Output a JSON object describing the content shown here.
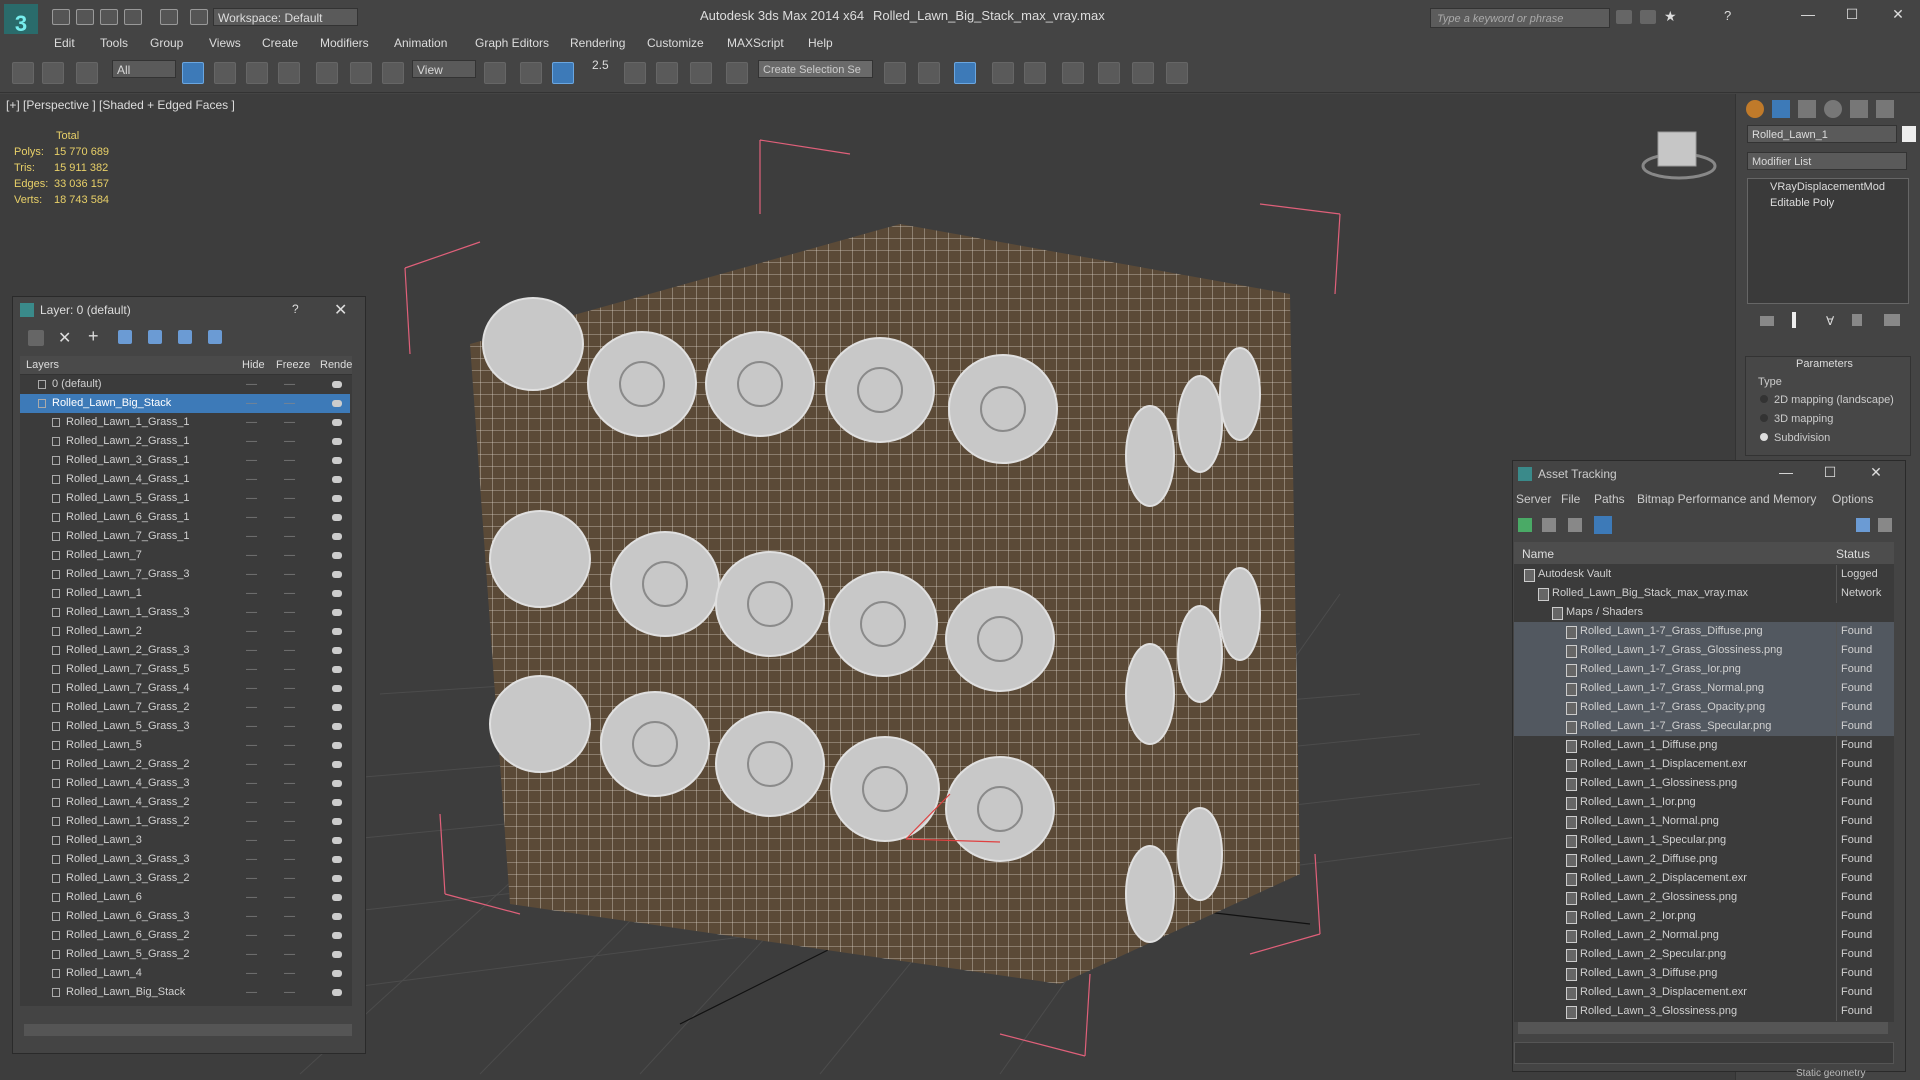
{
  "titlebar": {
    "workspace": "Workspace: Default",
    "app_title": "Autodesk 3ds Max  2014 x64",
    "file_title": "Rolled_Lawn_Big_Stack_max_vray.max",
    "search_placeholder": "Type a keyword or phrase"
  },
  "menu": [
    "Edit",
    "Tools",
    "Group",
    "Views",
    "Create",
    "Modifiers",
    "Animation",
    "Graph Editors",
    "Rendering",
    "Customize",
    "MAXScript",
    "Help"
  ],
  "toolbar": {
    "selection_filter": "All",
    "reference_coord": "View",
    "angle_snap": "2.5",
    "create_selection_set": "Create Selection Se"
  },
  "viewport": {
    "label": "[+] [Perspective ] [Shaded + Edged Faces ]",
    "stats_header": "Total",
    "stats": [
      {
        "label": "Polys:",
        "value": "15 770 689"
      },
      {
        "label": "Tris:",
        "value": "15 911 382"
      },
      {
        "label": "Edges:",
        "value": "33 036 157"
      },
      {
        "label": "Verts:",
        "value": "18 743 584"
      }
    ]
  },
  "layer_panel": {
    "title": "Layer: 0 (default)",
    "help": "?",
    "columns": [
      "Layers",
      "Hide",
      "Freeze",
      "Rende"
    ],
    "rows": [
      {
        "name": "0 (default)",
        "level": 1,
        "selected": false
      },
      {
        "name": "Rolled_Lawn_Big_Stack",
        "level": 1,
        "selected": true
      },
      {
        "name": "Rolled_Lawn_1_Grass_1",
        "level": 2,
        "selected": false
      },
      {
        "name": "Rolled_Lawn_2_Grass_1",
        "level": 2,
        "selected": false
      },
      {
        "name": "Rolled_Lawn_3_Grass_1",
        "level": 2,
        "selected": false
      },
      {
        "name": "Rolled_Lawn_4_Grass_1",
        "level": 2,
        "selected": false
      },
      {
        "name": "Rolled_Lawn_5_Grass_1",
        "level": 2,
        "selected": false
      },
      {
        "name": "Rolled_Lawn_6_Grass_1",
        "level": 2,
        "selected": false
      },
      {
        "name": "Rolled_Lawn_7_Grass_1",
        "level": 2,
        "selected": false
      },
      {
        "name": "Rolled_Lawn_7",
        "level": 2,
        "selected": false
      },
      {
        "name": "Rolled_Lawn_7_Grass_3",
        "level": 2,
        "selected": false
      },
      {
        "name": "Rolled_Lawn_1",
        "level": 2,
        "selected": false
      },
      {
        "name": "Rolled_Lawn_1_Grass_3",
        "level": 2,
        "selected": false
      },
      {
        "name": "Rolled_Lawn_2",
        "level": 2,
        "selected": false
      },
      {
        "name": "Rolled_Lawn_2_Grass_3",
        "level": 2,
        "selected": false
      },
      {
        "name": "Rolled_Lawn_7_Grass_5",
        "level": 2,
        "selected": false
      },
      {
        "name": "Rolled_Lawn_7_Grass_4",
        "level": 2,
        "selected": false
      },
      {
        "name": "Rolled_Lawn_7_Grass_2",
        "level": 2,
        "selected": false
      },
      {
        "name": "Rolled_Lawn_5_Grass_3",
        "level": 2,
        "selected": false
      },
      {
        "name": "Rolled_Lawn_5",
        "level": 2,
        "selected": false
      },
      {
        "name": "Rolled_Lawn_2_Grass_2",
        "level": 2,
        "selected": false
      },
      {
        "name": "Rolled_Lawn_4_Grass_3",
        "level": 2,
        "selected": false
      },
      {
        "name": "Rolled_Lawn_4_Grass_2",
        "level": 2,
        "selected": false
      },
      {
        "name": "Rolled_Lawn_1_Grass_2",
        "level": 2,
        "selected": false
      },
      {
        "name": "Rolled_Lawn_3",
        "level": 2,
        "selected": false
      },
      {
        "name": "Rolled_Lawn_3_Grass_3",
        "level": 2,
        "selected": false
      },
      {
        "name": "Rolled_Lawn_3_Grass_2",
        "level": 2,
        "selected": false
      },
      {
        "name": "Rolled_Lawn_6",
        "level": 2,
        "selected": false
      },
      {
        "name": "Rolled_Lawn_6_Grass_3",
        "level": 2,
        "selected": false
      },
      {
        "name": "Rolled_Lawn_6_Grass_2",
        "level": 2,
        "selected": false
      },
      {
        "name": "Rolled_Lawn_5_Grass_2",
        "level": 2,
        "selected": false
      },
      {
        "name": "Rolled_Lawn_4",
        "level": 2,
        "selected": false
      },
      {
        "name": "Rolled_Lawn_Big_Stack",
        "level": 2,
        "selected": false
      }
    ]
  },
  "command_panel": {
    "object_name": "Rolled_Lawn_1",
    "modifier_list": "Modifier List",
    "modifiers": [
      "VRayDisplacementMod",
      "Editable Poly"
    ],
    "parameters_title": "Parameters",
    "type_label": "Type",
    "type_options": [
      "2D mapping (landscape)",
      "3D mapping",
      "Subdivision"
    ],
    "type_selected": "Subdivision"
  },
  "asset_tracking": {
    "title": "Asset Tracking",
    "menu": [
      "Server",
      "File",
      "Paths",
      "Bitmap Performance and Memory",
      "Options"
    ],
    "columns": [
      "Name",
      "Status"
    ],
    "rows": [
      {
        "name": "Autodesk Vault",
        "status": "Logged",
        "level": 0,
        "highlight": false
      },
      {
        "name": "Rolled_Lawn_Big_Stack_max_vray.max",
        "status": "Network",
        "level": 1,
        "highlight": false
      },
      {
        "name": "Maps / Shaders",
        "status": "",
        "level": 2,
        "highlight": false
      },
      {
        "name": "Rolled_Lawn_1-7_Grass_Diffuse.png",
        "status": "Found",
        "level": 3,
        "highlight": true
      },
      {
        "name": "Rolled_Lawn_1-7_Grass_Glossiness.png",
        "status": "Found",
        "level": 3,
        "highlight": true
      },
      {
        "name": "Rolled_Lawn_1-7_Grass_Ior.png",
        "status": "Found",
        "level": 3,
        "highlight": true
      },
      {
        "name": "Rolled_Lawn_1-7_Grass_Normal.png",
        "status": "Found",
        "level": 3,
        "highlight": true
      },
      {
        "name": "Rolled_Lawn_1-7_Grass_Opacity.png",
        "status": "Found",
        "level": 3,
        "highlight": true
      },
      {
        "name": "Rolled_Lawn_1-7_Grass_Specular.png",
        "status": "Found",
        "level": 3,
        "highlight": true
      },
      {
        "name": "Rolled_Lawn_1_Diffuse.png",
        "status": "Found",
        "level": 3,
        "highlight": false
      },
      {
        "name": "Rolled_Lawn_1_Displacement.exr",
        "status": "Found",
        "level": 3,
        "highlight": false
      },
      {
        "name": "Rolled_Lawn_1_Glossiness.png",
        "status": "Found",
        "level": 3,
        "highlight": false
      },
      {
        "name": "Rolled_Lawn_1_Ior.png",
        "status": "Found",
        "level": 3,
        "highlight": false
      },
      {
        "name": "Rolled_Lawn_1_Normal.png",
        "status": "Found",
        "level": 3,
        "highlight": false
      },
      {
        "name": "Rolled_Lawn_1_Specular.png",
        "status": "Found",
        "level": 3,
        "highlight": false
      },
      {
        "name": "Rolled_Lawn_2_Diffuse.png",
        "status": "Found",
        "level": 3,
        "highlight": false
      },
      {
        "name": "Rolled_Lawn_2_Displacement.exr",
        "status": "Found",
        "level": 3,
        "highlight": false
      },
      {
        "name": "Rolled_Lawn_2_Glossiness.png",
        "status": "Found",
        "level": 3,
        "highlight": false
      },
      {
        "name": "Rolled_Lawn_2_Ior.png",
        "status": "Found",
        "level": 3,
        "highlight": false
      },
      {
        "name": "Rolled_Lawn_2_Normal.png",
        "status": "Found",
        "level": 3,
        "highlight": false
      },
      {
        "name": "Rolled_Lawn_2_Specular.png",
        "status": "Found",
        "level": 3,
        "highlight": false
      },
      {
        "name": "Rolled_Lawn_3_Diffuse.png",
        "status": "Found",
        "level": 3,
        "highlight": false
      },
      {
        "name": "Rolled_Lawn_3_Displacement.exr",
        "status": "Found",
        "level": 3,
        "highlight": false
      },
      {
        "name": "Rolled_Lawn_3_Glossiness.png",
        "status": "Found",
        "level": 3,
        "highlight": false
      }
    ],
    "footer": "Static geometry"
  },
  "colors": {
    "accent": "#3d7ab8",
    "stats_text": "#e8d068",
    "bounding_box": "#e0607a",
    "lawn_roll": "#5b4a37",
    "grass_end": "#c8c8c8"
  }
}
